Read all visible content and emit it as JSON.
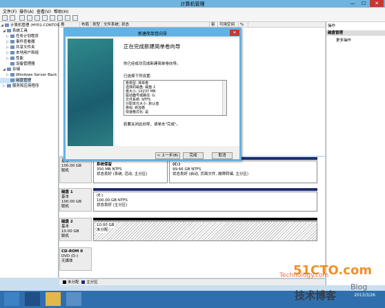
{
  "window": {
    "title": "计算机管理",
    "minimize": "—",
    "maximize": "☐",
    "close": "✕"
  },
  "menu": [
    "文件(F)",
    "操作(A)",
    "查看(V)",
    "帮助(H)"
  ],
  "tree": [
    {
      "label": "计算机管理 (HY01.CONTOSO",
      "indent": 0,
      "expander": "◢"
    },
    {
      "label": "系统工具",
      "indent": 1,
      "expander": "◢"
    },
    {
      "label": "任务计划程序",
      "indent": 2,
      "expander": "▷"
    },
    {
      "label": "事件查看器",
      "indent": 2,
      "expander": "▷"
    },
    {
      "label": "共享文件夹",
      "indent": 2,
      "expander": "▷"
    },
    {
      "label": "本地用户和组",
      "indent": 2,
      "expander": "▷"
    },
    {
      "label": "性能",
      "indent": 2,
      "expander": "▷"
    },
    {
      "label": "设备管理器",
      "indent": 2,
      "expander": ""
    },
    {
      "label": "存储",
      "indent": 1,
      "expander": "◢"
    },
    {
      "label": "Windows Server Back",
      "indent": 2,
      "expander": "▷"
    },
    {
      "label": "磁盘管理",
      "indent": 2,
      "expander": ""
    },
    {
      "label": "服务和应用程序",
      "indent": 1,
      "expander": "▷"
    }
  ],
  "volume_columns": [
    "卷",
    "布局",
    "类型",
    "文件系统",
    "状态",
    "容量",
    "可用空间",
    "%"
  ],
  "disks": [
    {
      "name": "",
      "type": "基本",
      "size": "100.00 GB",
      "status": "联机",
      "partitions": [
        {
          "title": "系统保留",
          "line1": "350 MB NTFS",
          "line2": "状态良好 (系统, 活动, 主分区)"
        },
        {
          "title": "(C:)",
          "line1": "99.66 GB NTFS",
          "line2": "状态良好 (启动, 页面文件, 故障转储, 主分区)"
        }
      ]
    },
    {
      "name": "磁盘 1",
      "type": "基本",
      "size": "100.00 GB",
      "status": "联机",
      "partitions": [
        {
          "title": "(E:)",
          "line1": "100.00 GB NTFS",
          "line2": "状态良好 (主分区)"
        }
      ]
    },
    {
      "name": "磁盘 2",
      "type": "基本",
      "size": "10.00 GB",
      "status": "联机",
      "partitions": [
        {
          "title": "",
          "line1": "10.00 GB",
          "line2": "未分配"
        }
      ]
    },
    {
      "name": "CD-ROM 0",
      "type": "DVD (D:)",
      "size": "",
      "status": "无媒体",
      "partitions": []
    }
  ],
  "legend": {
    "unallocated": "未分配",
    "primary": "主分区",
    "colors": {
      "unallocated": "#000000",
      "primary": "#1c2d70"
    }
  },
  "actions": {
    "header": "操作",
    "section": "磁盘管理",
    "more": "更多操作"
  },
  "dialog": {
    "title": "新建简单卷向导",
    "heading": "正在完成新建简单卷向导",
    "desc": "你已经成功完成新建简单卷向导。",
    "settings_label": "已选择下列设置:",
    "settings": [
      "卷类型: 简单卷",
      "选择的磁盘: 磁盘 2",
      "卷大小: 10237 MB",
      "驱动器号或路径: G:",
      "文件系统: NTFS",
      "分配单元大小: 默认值",
      "卷标: 新加卷",
      "快速格式化: 是"
    ],
    "close_text": "若要关闭此向导，请单击\"完成\"。",
    "back": "< 上一步(B)",
    "finish": "完成",
    "cancel": "取消"
  },
  "taskbar": {
    "time": "",
    "date": "2013/3/26"
  },
  "watermark": {
    "logo": "51CTO.com",
    "site": "Technology.com",
    "cn": "技术博客",
    "blog": "Blog"
  }
}
